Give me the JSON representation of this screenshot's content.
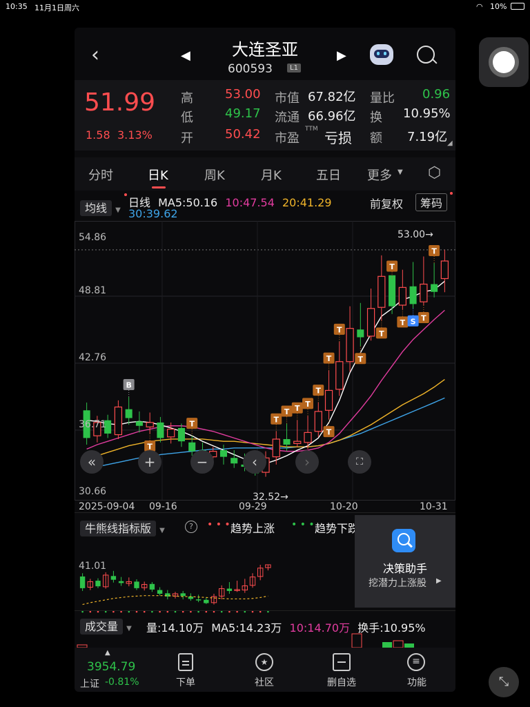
{
  "status": {
    "time": "10:35",
    "date": "11月1日周六",
    "battery": "10%"
  },
  "header": {
    "title": "大连圣亚",
    "code": "600593",
    "level": "L1"
  },
  "quote": {
    "price": "51.99",
    "change": "1.58",
    "change_pct": "3.13%",
    "high_label": "高",
    "high": "53.00",
    "low_label": "低",
    "low": "49.17",
    "open_label": "开",
    "open": "50.42",
    "mcap_label": "市值",
    "mcap": "67.82亿",
    "float_label": "流通",
    "float": "66.96亿",
    "pe_label": "市盈",
    "pe_sup": "TTM",
    "pe": "亏损",
    "vr_label": "量比",
    "vr": "0.96",
    "turn_label": "换",
    "turn": "10.95%",
    "amt_label": "额",
    "amt": "7.19亿"
  },
  "tabs": [
    "分时",
    "日K",
    "周K",
    "月K",
    "五日",
    "更多"
  ],
  "ma": {
    "chip": "均线",
    "line": "日线",
    "ma5": "MA5:50.16",
    "ma10": "10:47.54",
    "ma20": "20:41.29",
    "ma30": "30:39.62",
    "adjust": "前复权",
    "chouma": "筹码"
  },
  "chart_data": {
    "type": "candlestick",
    "yticks": [
      "54.86",
      "48.81",
      "42.76",
      "36.71",
      "30.66"
    ],
    "xticks": [
      "2025-09-04",
      "09-16",
      "09-29",
      "10-20",
      "10-31"
    ],
    "ylim": [
      30.66,
      54.86
    ],
    "high_marker": "53.00→",
    "low_marker": "32.52→",
    "markers": [
      "B",
      "T",
      "S"
    ],
    "candles": [
      [
        38.5,
        36.0,
        39.2,
        35.4
      ],
      [
        36.2,
        37.4,
        38.0,
        35.6
      ],
      [
        37.6,
        36.4,
        38.1,
        36.0
      ],
      [
        36.3,
        38.8,
        39.4,
        35.9
      ],
      [
        38.6,
        37.8,
        39.7,
        37.2
      ],
      [
        37.5,
        37.1,
        38.4,
        36.5
      ],
      [
        37.0,
        37.4,
        38.3,
        36.4
      ],
      [
        37.4,
        36.0,
        37.9,
        35.6
      ],
      [
        36.1,
        36.8,
        37.4,
        35.5
      ],
      [
        36.9,
        35.7,
        37.3,
        35.2
      ],
      [
        35.6,
        34.8,
        36.2,
        34.4
      ],
      [
        34.9,
        34.2,
        35.6,
        33.6
      ],
      [
        34.3,
        34.8,
        35.2,
        33.8
      ],
      [
        34.9,
        34.3,
        35.4,
        33.6
      ],
      [
        34.2,
        33.7,
        34.9,
        33.3
      ],
      [
        33.6,
        33.4,
        34.6,
        33.0
      ],
      [
        33.5,
        32.8,
        34.0,
        32.6
      ],
      [
        32.9,
        34.2,
        34.8,
        32.5
      ],
      [
        34.3,
        35.9,
        36.6,
        33.6
      ],
      [
        35.9,
        35.4,
        37.3,
        34.8
      ],
      [
        35.5,
        35.7,
        37.6,
        35.2
      ],
      [
        35.6,
        36.5,
        38.0,
        35.0
      ],
      [
        36.6,
        38.4,
        39.2,
        36.1
      ],
      [
        38.5,
        40.3,
        42.1,
        37.7
      ],
      [
        40.4,
        42.9,
        44.7,
        39.8
      ],
      [
        42.9,
        45.9,
        47.9,
        42.0
      ],
      [
        45.8,
        45.1,
        48.2,
        44.3
      ],
      [
        45.2,
        47.7,
        49.5,
        44.8
      ],
      [
        47.8,
        50.6,
        52.5,
        46.6
      ],
      [
        50.7,
        47.9,
        50.4,
        47.2
      ],
      [
        48.0,
        49.6,
        51.2,
        47.6
      ],
      [
        49.7,
        48.1,
        51.9,
        47.7
      ],
      [
        48.3,
        49.9,
        52.4,
        48.0
      ],
      [
        49.9,
        49.2,
        51.8,
        48.7
      ],
      [
        50.4,
        51.99,
        53.0,
        49.17
      ]
    ],
    "ma5": [
      37.6,
      37.5,
      37.3,
      37.2,
      37.4,
      37.5,
      37.4,
      37.2,
      36.9,
      36.6,
      36.2,
      35.7,
      35.3,
      34.9,
      34.5,
      34.1,
      33.8,
      33.7,
      34.0,
      34.4,
      34.9,
      35.3,
      36.0,
      37.4,
      39.4,
      41.9,
      43.7,
      45.4,
      47.0,
      47.7,
      48.5,
      48.8,
      49.2,
      49.4,
      50.16
    ],
    "ma10": [
      35.0,
      35.4,
      35.7,
      36.0,
      36.3,
      36.6,
      36.8,
      37.0,
      37.1,
      37.1,
      37.0,
      36.8,
      36.6,
      36.3,
      36.0,
      35.7,
      35.4,
      35.1,
      34.9,
      34.8,
      34.8,
      34.9,
      35.1,
      35.6,
      36.4,
      37.5,
      38.6,
      39.8,
      41.2,
      42.5,
      43.8,
      44.9,
      45.8,
      46.7,
      47.54
    ],
    "ma20": [
      34.0,
      34.4,
      34.7,
      35.0,
      35.3,
      35.5,
      35.7,
      35.8,
      35.9,
      35.9,
      35.9,
      35.9,
      35.8,
      35.7,
      35.7,
      35.6,
      35.5,
      35.4,
      35.3,
      35.2,
      35.2,
      35.2,
      35.3,
      35.5,
      35.8,
      36.2,
      36.7,
      37.2,
      37.8,
      38.4,
      39.0,
      39.5,
      40.0,
      40.6,
      41.29
    ],
    "ma30": [
      33.2,
      33.4,
      33.6,
      33.8,
      34.0,
      34.2,
      34.3,
      34.5,
      34.6,
      34.7,
      34.8,
      34.9,
      35.0,
      35.0,
      35.1,
      35.1,
      35.1,
      35.1,
      35.1,
      35.1,
      35.2,
      35.2,
      35.3,
      35.5,
      35.8,
      36.1,
      36.4,
      36.8,
      37.2,
      37.6,
      38.0,
      38.4,
      38.8,
      39.2,
      39.62
    ]
  },
  "indicator": {
    "chip": "牛熊线指标版",
    "up": "趋势上涨",
    "down": "趋势下跌",
    "ytick": "41.01"
  },
  "decision": {
    "title": "决策助手",
    "sub": "挖潜力上涨股"
  },
  "volume": {
    "chip": "成交量",
    "vol": "量:14.10万",
    "ma5": "MA5:14.23万",
    "ma10": "10:14.70万",
    "turn": "换手:10.95%"
  },
  "bottom": {
    "index_val": "3954.79",
    "index_name": "上证",
    "index_pct": "-0.81%",
    "items": [
      "下单",
      "社区",
      "删自选",
      "功能"
    ]
  },
  "colors": {
    "up": "#ff4d4f",
    "down": "#2ec24a",
    "t_marker": "#b5651d",
    "ma5": "#ffffff",
    "ma10": "#e23c9f",
    "ma20": "#f0b429",
    "ma30": "#3ea4e8"
  }
}
